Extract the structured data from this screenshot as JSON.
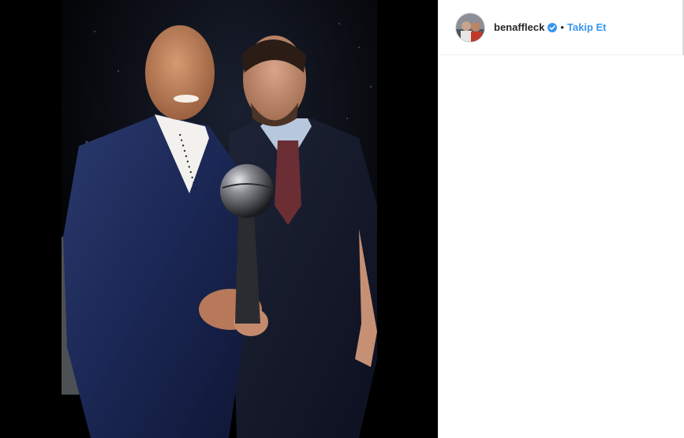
{
  "post": {
    "username": "benaffleck",
    "separator": "•",
    "follow_label": "Takip Et",
    "verified": true
  },
  "colors": {
    "follow_blue": "#3897f0",
    "verified_blue": "#3897f0",
    "text": "#262626",
    "photo_background": "#000000",
    "panel_background": "#ffffff"
  },
  "icons": {
    "verified": "verified-badge-icon"
  }
}
